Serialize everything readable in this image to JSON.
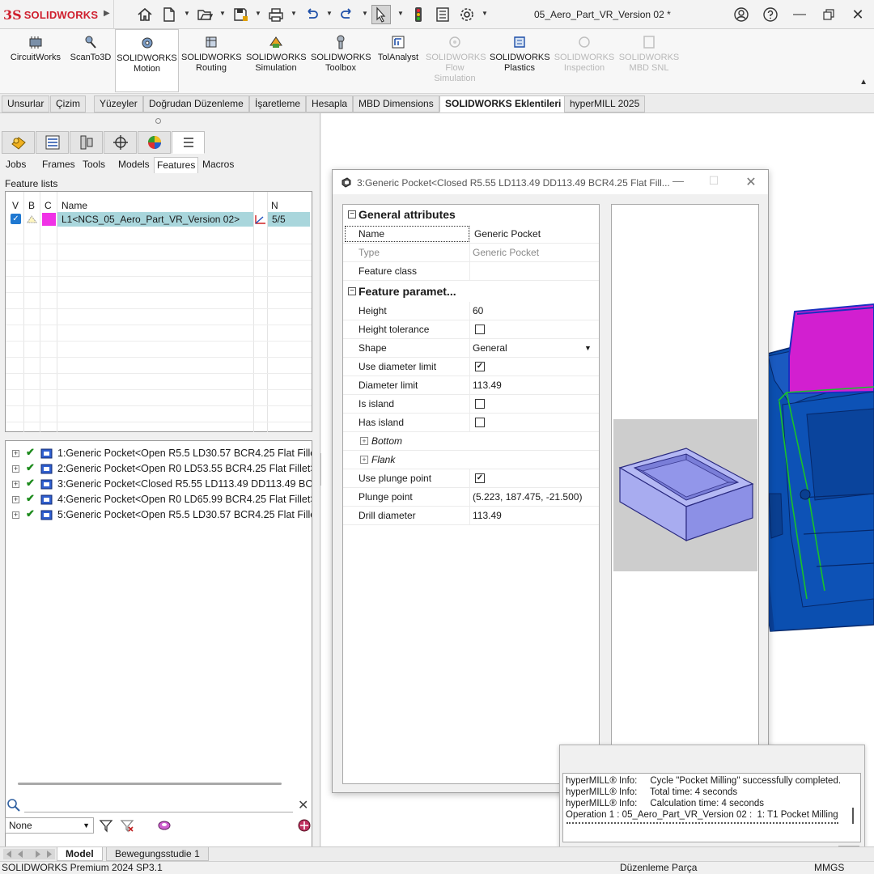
{
  "titlebar": {
    "app_name": "SOLIDWORKS",
    "document_title": "05_Aero_Part_VR_Version 02 *"
  },
  "ribbon": {
    "items": [
      {
        "label1": "CircuitWorks",
        "label2": "",
        "label3": "",
        "icon": "circuitworks-icon",
        "enabled": true
      },
      {
        "label1": "ScanTo3D",
        "label2": "",
        "label3": "",
        "icon": "scanto3d-icon",
        "enabled": true
      },
      {
        "label1": "SOLIDWORKS",
        "label2": "Motion",
        "label3": "",
        "icon": "motion-icon",
        "enabled": true,
        "selected": true
      },
      {
        "label1": "SOLIDWORKS",
        "label2": "Routing",
        "label3": "",
        "icon": "routing-icon",
        "enabled": true
      },
      {
        "label1": "SOLIDWORKS",
        "label2": "Simulation",
        "label3": "",
        "icon": "simulation-icon",
        "enabled": true
      },
      {
        "label1": "SOLIDWORKS",
        "label2": "Toolbox",
        "label3": "",
        "icon": "toolbox-icon",
        "enabled": true
      },
      {
        "label1": "TolAnalyst",
        "label2": "",
        "label3": "",
        "icon": "tolanalyst-icon",
        "enabled": true
      },
      {
        "label1": "SOLIDWORKS",
        "label2": "Flow",
        "label3": "Simulation",
        "icon": "flow-simulation-icon",
        "enabled": false
      },
      {
        "label1": "SOLIDWORKS",
        "label2": "Plastics",
        "label3": "",
        "icon": "plastics-icon",
        "enabled": true
      },
      {
        "label1": "SOLIDWORKS",
        "label2": "Inspection",
        "label3": "",
        "icon": "inspection-icon",
        "enabled": false
      },
      {
        "label1": "SOLIDWORKS",
        "label2": "MBD SNL",
        "label3": "",
        "icon": "mbd-snl-icon",
        "enabled": false
      }
    ]
  },
  "cm_tabs": [
    "Unsurlar",
    "Çizim",
    "Yüzeyler",
    "Doğrudan Düzenleme",
    "İşaretleme",
    "Hesapla",
    "MBD Dimensions",
    "SOLIDWORKS Eklentileri",
    "hyperMILL 2025"
  ],
  "cm_active": "SOLIDWORKS Eklentileri",
  "left_panel": {
    "hm_tabs": [
      "Jobs",
      "Frames",
      "Tools",
      "Models",
      "Features",
      "Macros"
    ],
    "hm_active": "Features",
    "feature_lists_label": "Feature lists",
    "columns": {
      "v": "V",
      "b": "B",
      "c": "C",
      "name": "Name",
      "n": "N"
    },
    "feature_list_row": {
      "name": "L1<NCS_05_Aero_Part_VR_Version 02>",
      "n": "5/5",
      "color": "#f032e6",
      "checked": true
    },
    "features": [
      "1:Generic Pocket<Open R5.5 LD30.57 BCR4.25 Flat Fillet>",
      "2:Generic Pocket<Open R0 LD53.55 BCR4.25 Flat Fillet>",
      "3:Generic Pocket<Closed R5.55 LD113.49 DD113.49 BCR4",
      "4:Generic Pocket<Open R0 LD65.99 BCR4.25 Flat Fillet>",
      "5:Generic Pocket<Open R5.5 LD30.57 BCR4.25 Flat Fillet>"
    ],
    "search_placeholder": "",
    "filter_select": "None"
  },
  "dialog": {
    "title": "3:Generic Pocket<Closed R5.55 LD113.49 DD113.49 BCR4.25 Flat Fill...",
    "sections": {
      "general": "General attributes",
      "params": "Feature paramet..."
    },
    "rows": {
      "name": {
        "k": "Name",
        "v": "Generic Pocket"
      },
      "type": {
        "k": "Type",
        "v": "Generic Pocket"
      },
      "feature_class": {
        "k": "Feature class",
        "v": ""
      },
      "height": {
        "k": "Height",
        "v": "60"
      },
      "height_tolerance": {
        "k": "Height tolerance",
        "checked": false
      },
      "shape": {
        "k": "Shape",
        "v": "General"
      },
      "use_diameter_limit": {
        "k": "Use diameter limit",
        "checked": true
      },
      "diameter_limit": {
        "k": "Diameter limit",
        "v": "113.49"
      },
      "is_island": {
        "k": "Is island",
        "checked": false
      },
      "has_island": {
        "k": "Has island",
        "checked": false
      },
      "bottom": {
        "k": "Bottom"
      },
      "flank": {
        "k": "Flank"
      },
      "use_plunge_point": {
        "k": "Use plunge point",
        "checked": true
      },
      "plunge_point": {
        "k": "Plunge point",
        "v": "(5.223, 187.475, -21.500)"
      },
      "drill_diameter": {
        "k": "Drill diameter",
        "v": "113.49"
      }
    }
  },
  "info_window": {
    "lines": [
      "hyperMILL® Info:     Cycle \"Pocket Milling\" successfully completed.",
      "hyperMILL® Info:     Total time: 4 seconds",
      "hyperMILL® Info:     Calculation time: 4 seconds",
      "Operation 1 : 05_Aero_Part_VR_Version 02 :  1: T1 Pocket Milling"
    ]
  },
  "bottom_tabs": [
    "Model",
    "Bewegungsstudie 1"
  ],
  "bottom_active": "Model",
  "status": {
    "left": "SOLIDWORKS Premium 2024 SP3.1",
    "mode": "Düzenleme Parça",
    "units": "MMGS"
  },
  "colors": {
    "brand_red": "#cf1f2e",
    "part_blue": "#0b4fb0",
    "pocket_magenta": "#d21fd0",
    "toolpath_green": "#19c22a",
    "selection_teal": "#a9d6dc"
  }
}
